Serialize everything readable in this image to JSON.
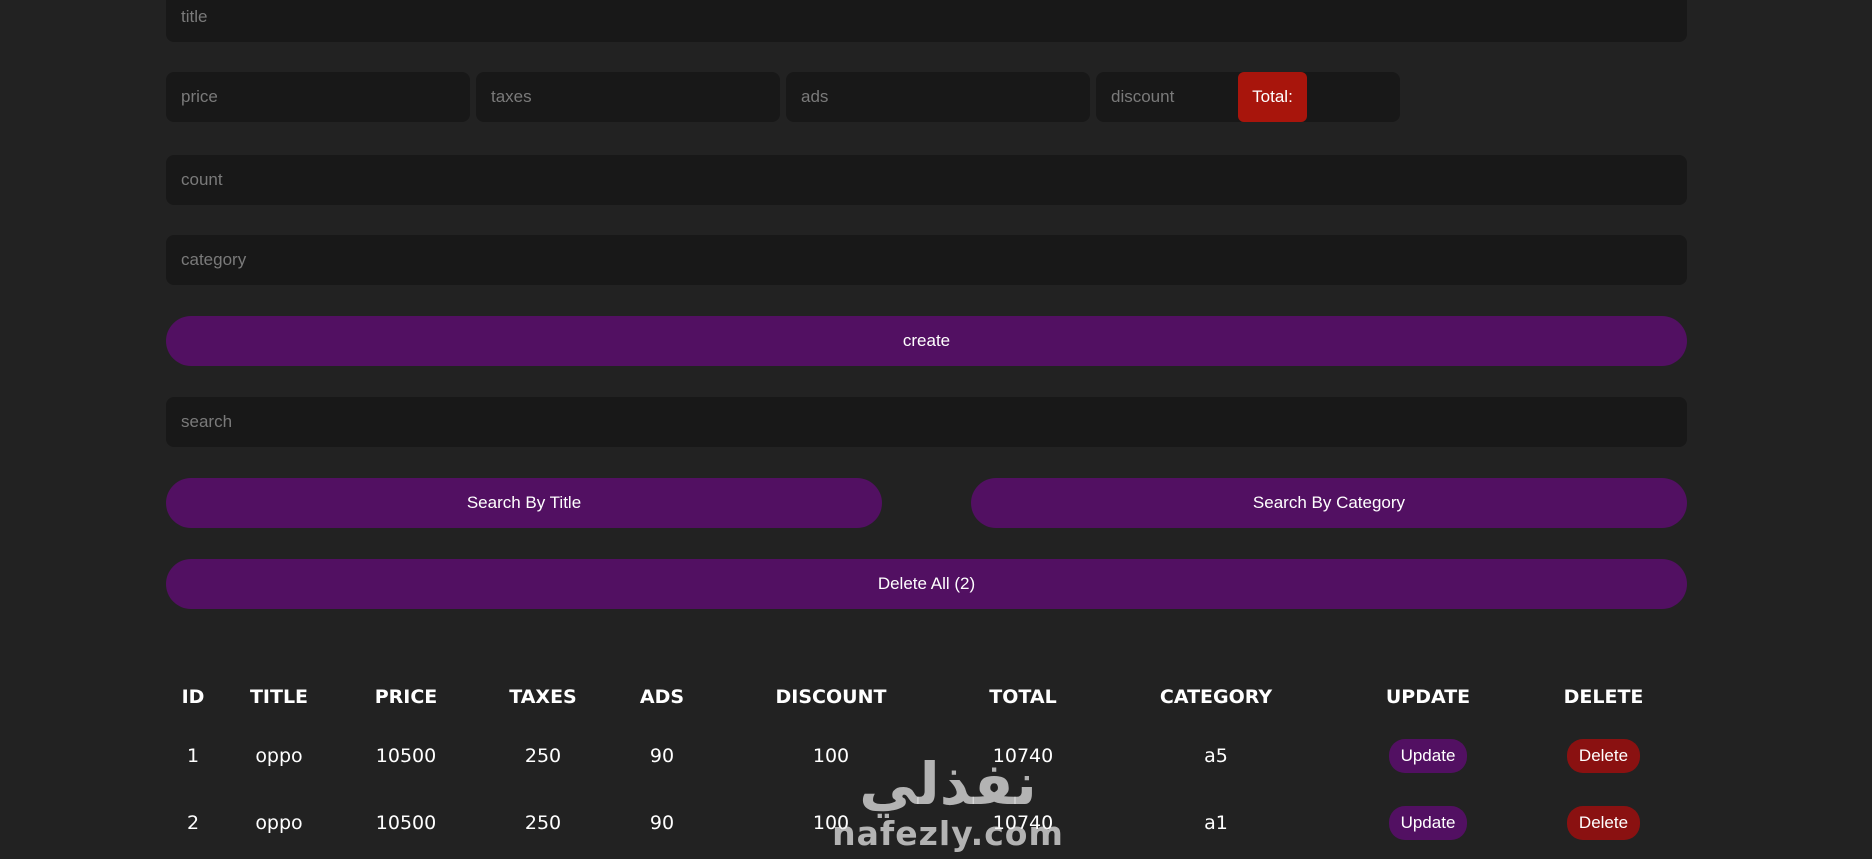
{
  "form": {
    "title_placeholder": "title",
    "price_placeholder": "price",
    "taxes_placeholder": "taxes",
    "ads_placeholder": "ads",
    "discount_placeholder": "discount",
    "total_label": "Total:",
    "count_placeholder": "count",
    "category_placeholder": "category",
    "create_label": "create"
  },
  "search": {
    "placeholder": "search",
    "by_title_label": "Search By Title",
    "by_category_label": "Search By Category"
  },
  "delete_all_label": "Delete All (2)",
  "table": {
    "headers": [
      "ID",
      "TITLE",
      "PRICE",
      "TAXES",
      "ADS",
      "DISCOUNT",
      "TOTAL",
      "CATEGORY",
      "UPDATE",
      "DELETE"
    ],
    "rows": [
      {
        "id": "1",
        "title": "oppo",
        "price": "10500",
        "taxes": "250",
        "ads": "90",
        "discount": "100",
        "total": "10740",
        "category": "a5",
        "update": "Update",
        "delete": "Delete"
      },
      {
        "id": "2",
        "title": "oppo",
        "price": "10500",
        "taxes": "250",
        "ads": "90",
        "discount": "100",
        "total": "10740",
        "category": "a1",
        "update": "Update",
        "delete": "Delete"
      }
    ]
  },
  "watermark": {
    "arabic": "نفذلي",
    "latin": "nafezly.com"
  },
  "colors": {
    "background": "#222222",
    "input_bg": "#181818",
    "primary": "#521062",
    "total_bg": "#a8150c",
    "delete_bg": "#8a1111"
  }
}
